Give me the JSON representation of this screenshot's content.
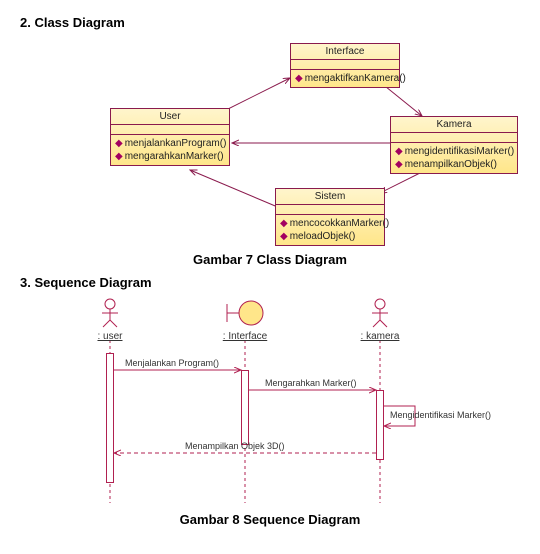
{
  "sections": {
    "class_heading": "2.      Class Diagram",
    "class_caption": "Gambar 7 Class Diagram",
    "seq_heading": "3.      Sequence Diagram",
    "seq_caption": "Gambar 8 Sequence Diagram"
  },
  "classes": {
    "interface": {
      "name": "Interface",
      "ops": [
        "mengaktifkanKamera()"
      ]
    },
    "user": {
      "name": "User",
      "ops": [
        "menjalankanProgram()",
        "mengarahkanMarker()"
      ]
    },
    "kamera": {
      "name": "Kamera",
      "ops": [
        "mengidentifikasiMarker()",
        "menampilkanObjek()"
      ]
    },
    "sistem": {
      "name": "Sistem",
      "ops": [
        "mencocokkanMarker()",
        "meloadObjek()"
      ]
    }
  },
  "sequence": {
    "lifelines": {
      "user": ": user",
      "interface": ": Interface",
      "kamera": ": kamera"
    },
    "messages": {
      "m1": "Menjalankan Program()",
      "m2": "Mengarahkan Marker()",
      "m3": "Mengidentifikasi Marker()",
      "m4": "Menampilkan Objek 3D()"
    }
  },
  "chart_data": [
    {
      "type": "uml-class-diagram",
      "classes": [
        {
          "name": "Interface",
          "operations": [
            "mengaktifkanKamera()"
          ]
        },
        {
          "name": "User",
          "operations": [
            "menjalankanProgram()",
            "mengarahkanMarker()"
          ]
        },
        {
          "name": "Kamera",
          "operations": [
            "mengidentifikasiMarker()",
            "menampilkanObjek()"
          ]
        },
        {
          "name": "Sistem",
          "operations": [
            "mencocokkanMarker()",
            "meloadObjek()"
          ]
        }
      ],
      "associations": [
        {
          "from": "User",
          "to": "Interface",
          "direction": "to"
        },
        {
          "from": "Interface",
          "to": "Kamera",
          "direction": "to"
        },
        {
          "from": "Kamera",
          "to": "User",
          "direction": "to"
        },
        {
          "from": "Kamera",
          "to": "Sistem",
          "direction": "to"
        },
        {
          "from": "Sistem",
          "to": "User",
          "direction": "to"
        }
      ]
    },
    {
      "type": "uml-sequence-diagram",
      "lifelines": [
        "user",
        "Interface",
        "kamera"
      ],
      "messages": [
        {
          "from": "user",
          "to": "Interface",
          "label": "Menjalankan Program()"
        },
        {
          "from": "Interface",
          "to": "kamera",
          "label": "Mengarahkan Marker()"
        },
        {
          "from": "kamera",
          "to": "kamera",
          "label": "Mengidentifikasi Marker()"
        },
        {
          "from": "kamera",
          "to": "user",
          "label": "Menampilkan Objek 3D()",
          "return": true
        }
      ]
    }
  ]
}
